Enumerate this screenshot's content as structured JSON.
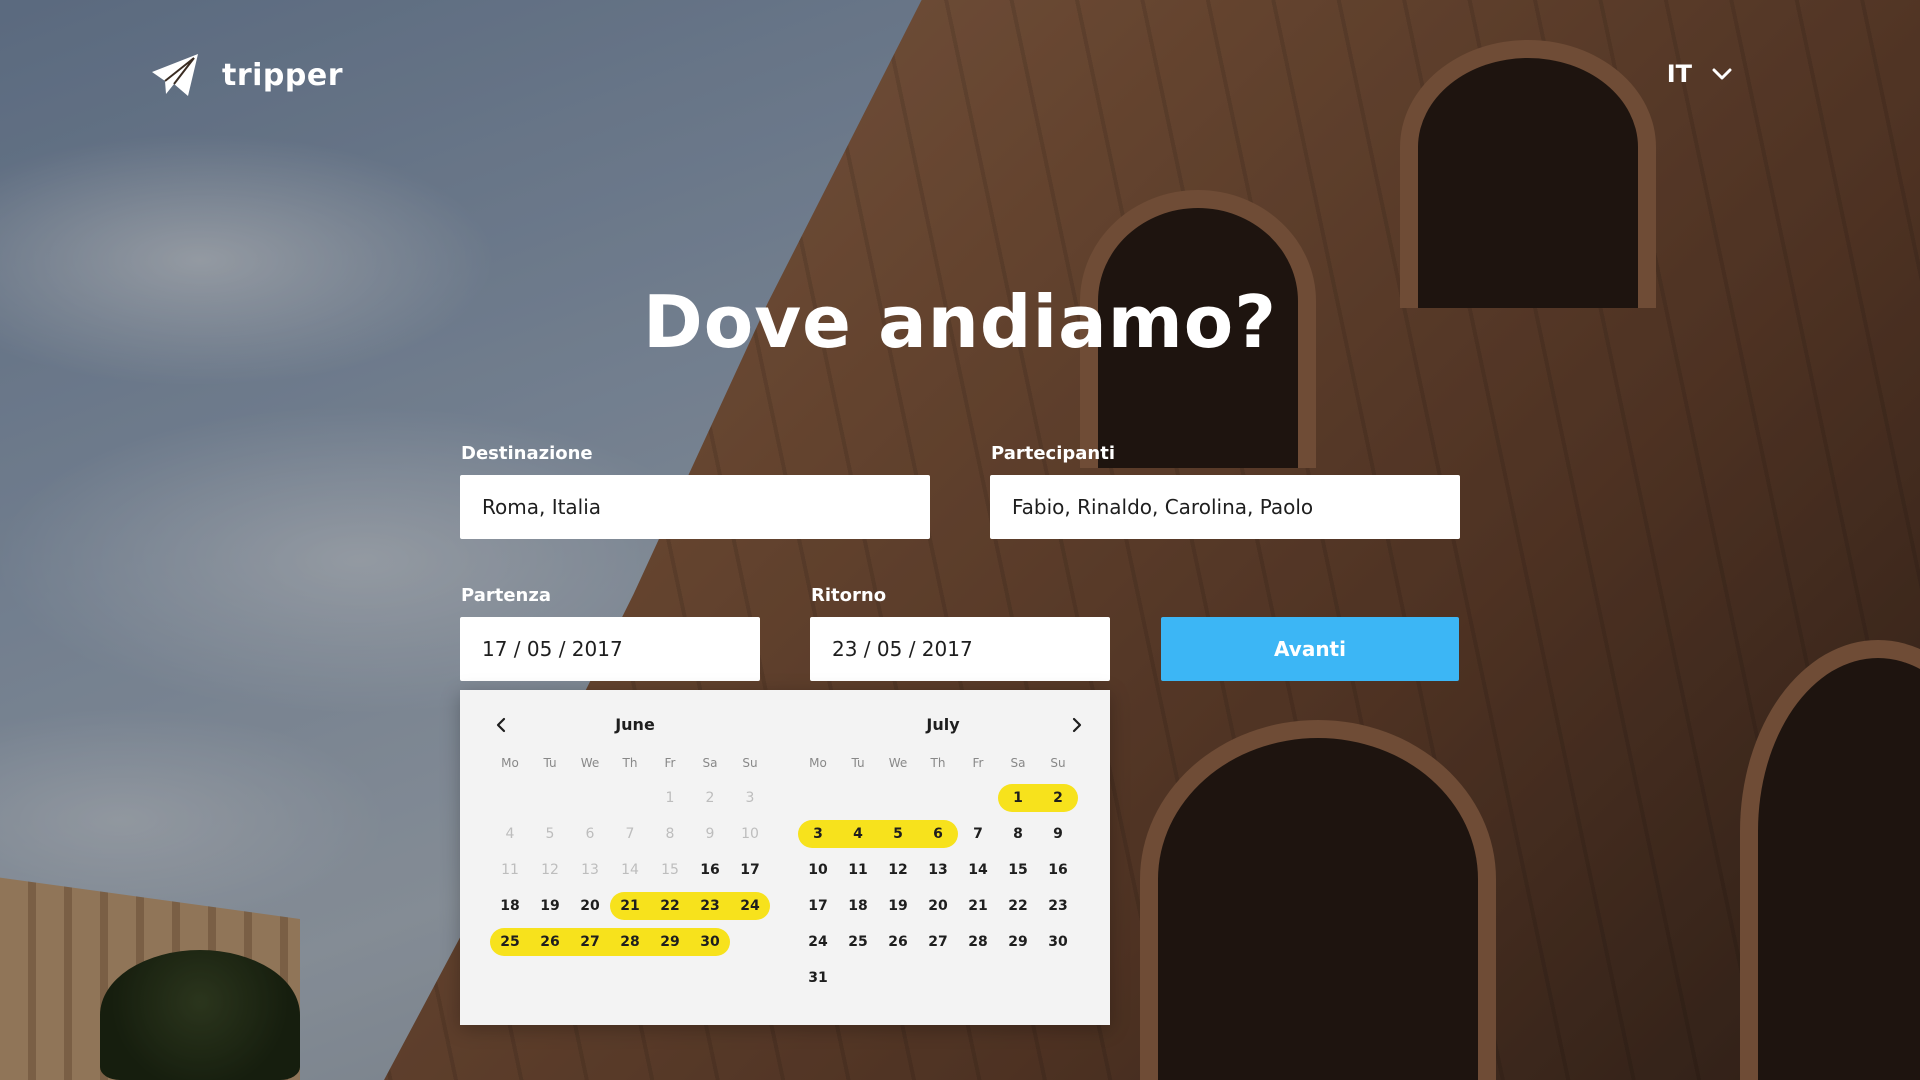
{
  "app": {
    "logo_text": "tripper",
    "language": "IT"
  },
  "hero": {
    "title": "Dove andiamo?"
  },
  "form": {
    "destination": {
      "label": "Destinazione",
      "value": "Roma, Italia"
    },
    "participants": {
      "label": "Partecipanti",
      "value": "Fabio, Rinaldo, Carolina, Paolo"
    },
    "departure": {
      "label": "Partenza",
      "value": "17 / 05 / 2017"
    },
    "return": {
      "label": "Ritorno",
      "value": "23 / 05 / 2017"
    },
    "submit_label": "Avanti"
  },
  "calendar": {
    "weekdays": [
      "Mo",
      "Tu",
      "We",
      "Th",
      "Fr",
      "Sa",
      "Su"
    ],
    "highlight_color": "#f7e21c",
    "months": [
      {
        "name": "June",
        "days": [
          {
            "d": ""
          },
          {
            "d": ""
          },
          {
            "d": ""
          },
          {
            "d": ""
          },
          {
            "d": "1",
            "m": 1
          },
          {
            "d": "2",
            "m": 1
          },
          {
            "d": "3",
            "m": 1
          },
          {
            "d": "4",
            "m": 1
          },
          {
            "d": "5",
            "m": 1
          },
          {
            "d": "6",
            "m": 1
          },
          {
            "d": "7",
            "m": 1
          },
          {
            "d": "8",
            "m": 1
          },
          {
            "d": "9",
            "m": 1
          },
          {
            "d": "10",
            "m": 1
          },
          {
            "d": "11",
            "m": 1
          },
          {
            "d": "12",
            "m": 1
          },
          {
            "d": "13",
            "m": 1
          },
          {
            "d": "14",
            "m": 1
          },
          {
            "d": "15",
            "m": 1
          },
          {
            "d": "16"
          },
          {
            "d": "17"
          },
          {
            "d": "18"
          },
          {
            "d": "19"
          },
          {
            "d": "20"
          },
          {
            "d": "21",
            "s": "start"
          },
          {
            "d": "22",
            "s": "mid"
          },
          {
            "d": "23",
            "s": "mid"
          },
          {
            "d": "24",
            "s": "end"
          },
          {
            "d": "25",
            "s": "start"
          },
          {
            "d": "26",
            "s": "mid"
          },
          {
            "d": "27",
            "s": "mid"
          },
          {
            "d": "28",
            "s": "mid"
          },
          {
            "d": "29",
            "s": "mid"
          },
          {
            "d": "30",
            "s": "end"
          }
        ]
      },
      {
        "name": "July",
        "days": [
          {
            "d": ""
          },
          {
            "d": ""
          },
          {
            "d": ""
          },
          {
            "d": ""
          },
          {
            "d": ""
          },
          {
            "d": "1",
            "s": "start"
          },
          {
            "d": "2",
            "s": "end"
          },
          {
            "d": "3",
            "s": "start"
          },
          {
            "d": "4",
            "s": "mid"
          },
          {
            "d": "5",
            "s": "mid"
          },
          {
            "d": "6",
            "s": "end"
          },
          {
            "d": "7"
          },
          {
            "d": "8"
          },
          {
            "d": "9"
          },
          {
            "d": "10"
          },
          {
            "d": "11"
          },
          {
            "d": "12"
          },
          {
            "d": "13"
          },
          {
            "d": "14"
          },
          {
            "d": "15"
          },
          {
            "d": "16"
          },
          {
            "d": "17"
          },
          {
            "d": "18"
          },
          {
            "d": "19"
          },
          {
            "d": "20"
          },
          {
            "d": "21"
          },
          {
            "d": "22"
          },
          {
            "d": "23"
          },
          {
            "d": "24"
          },
          {
            "d": "25"
          },
          {
            "d": "26"
          },
          {
            "d": "27"
          },
          {
            "d": "28"
          },
          {
            "d": "29"
          },
          {
            "d": "30"
          },
          {
            "d": "31"
          }
        ]
      }
    ]
  }
}
